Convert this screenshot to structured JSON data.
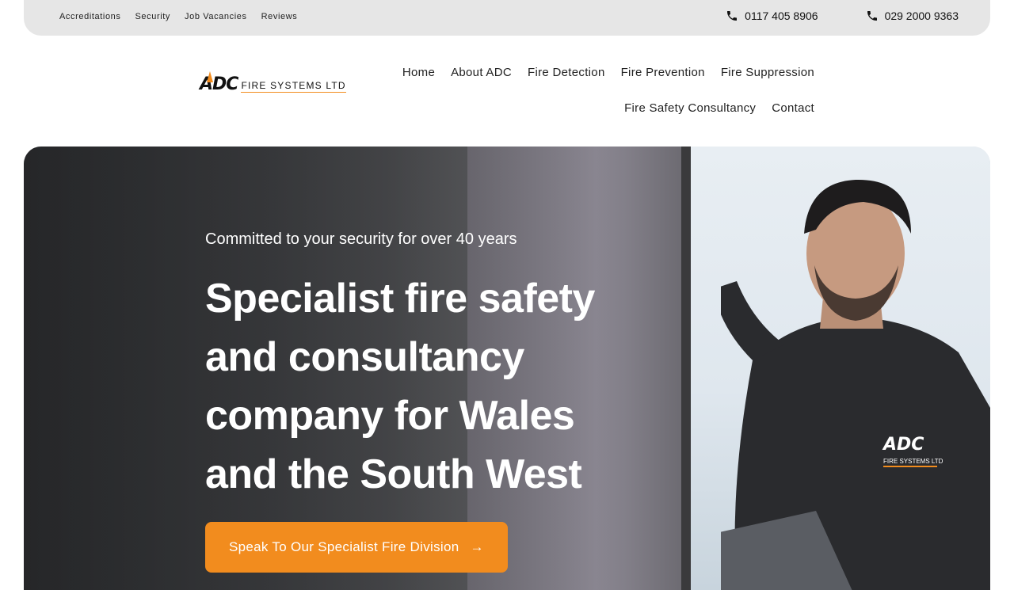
{
  "topbar": {
    "links": [
      "Accreditations",
      "Security",
      "Job Vacancies",
      "Reviews"
    ],
    "phones": [
      "0117 405 8906",
      "029 2000 9363"
    ]
  },
  "logo": {
    "mark": "ADC",
    "text": "FIRE SYSTEMS LTD"
  },
  "nav": {
    "row1": [
      "Home",
      "About ADC",
      "Fire Detection",
      "Fire Prevention",
      "Fire Suppression"
    ],
    "row2": [
      "Fire Safety Consultancy",
      "Contact"
    ]
  },
  "hero": {
    "tagline": "Committed to your security for over 40 years",
    "headline": "Specialist fire safety and consultancy company for Wales and the South West",
    "cta": "Speak To Our Specialist Fire Division",
    "cta_arrow": "→",
    "jacket_logo_mark": "ADC",
    "jacket_logo_text": "FIRE SYSTEMS LTD"
  },
  "colors": {
    "accent": "#f28c1e",
    "topbar": "#e6e6e6"
  },
  "icons": {
    "phone": "phone-icon",
    "arrow": "arrow-right-icon"
  }
}
